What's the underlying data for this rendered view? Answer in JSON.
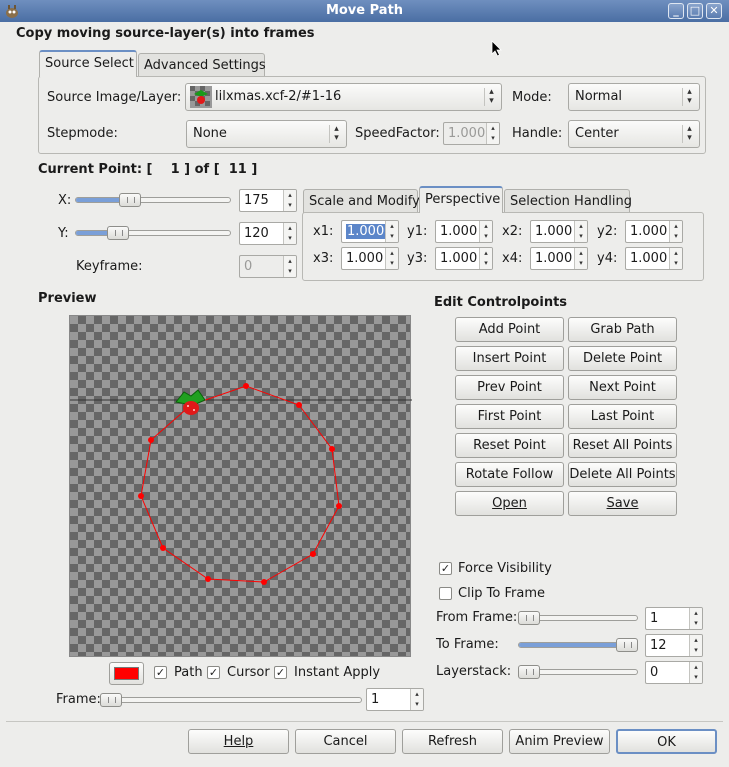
{
  "window": {
    "title": "Move Path",
    "controls": {
      "minimize": "_",
      "maximize": "□",
      "close": "✕"
    }
  },
  "header": "Copy moving source-layer(s) into frames",
  "tabs": {
    "source_select": "Source Select",
    "advanced_settings": "Advanced Settings"
  },
  "source": {
    "image_layer_label": "Source Image/Layer:",
    "image_layer_value": "lilxmas.xcf-2/#1-16",
    "mode_label": "Mode:",
    "mode_value": "Normal",
    "stepmode_label": "Stepmode:",
    "stepmode_value": "None",
    "speedfactor_label": "SpeedFactor:",
    "speedfactor_value": "1.000",
    "handle_label": "Handle:",
    "handle_value": "Center"
  },
  "current_point": {
    "text": "Current Point: [    1 ] of [  11 ]",
    "x_label": "X:",
    "x_value": "175",
    "x_level": 0.33,
    "y_label": "Y:",
    "y_value": "120",
    "y_level": 0.24,
    "keyframe_label": "Keyframe:",
    "keyframe_value": "0"
  },
  "modify_tabs": {
    "scale": "Scale and Modify",
    "perspective": "Perspective",
    "selection": "Selection Handling"
  },
  "perspective": [
    {
      "label": "x1:",
      "value": "1.000"
    },
    {
      "label": "y1:",
      "value": "1.000"
    },
    {
      "label": "x2:",
      "value": "1.000"
    },
    {
      "label": "y2:",
      "value": "1.000"
    },
    {
      "label": "x3:",
      "value": "1.000"
    },
    {
      "label": "y3:",
      "value": "1.000"
    },
    {
      "label": "x4:",
      "value": "1.000"
    },
    {
      "label": "y4:",
      "value": "1.000"
    }
  ],
  "preview": {
    "label": "Preview",
    "path_color": "#ff0000",
    "path_label": "Path",
    "cursor_label": "Cursor",
    "instant_apply_label": "Instant Apply",
    "frame_label": "Frame:",
    "frame_value": "1",
    "frame_level": 0.0
  },
  "controlpoints": {
    "title": "Edit Controlpoints",
    "buttons": [
      "Add Point",
      "Grab Path",
      "Insert Point",
      "Delete Point",
      "Prev Point",
      "Next Point",
      "First Point",
      "Last Point",
      "Reset Point",
      "Reset All Points",
      "Rotate Follow",
      "Delete All Points",
      "Open",
      "Save"
    ]
  },
  "options": {
    "force_visibility": "Force Visibility",
    "clip_to_frame": "Clip To Frame",
    "from_frame_label": "From Frame:",
    "from_frame_value": "1",
    "from_frame_level": 0.0,
    "to_frame_label": "To Frame:",
    "to_frame_value": "12",
    "to_frame_level": 1.0,
    "layerstack_label": "Layerstack:",
    "layerstack_value": "0",
    "layerstack_level": 0.0
  },
  "footer": {
    "help": "Help",
    "cancel": "Cancel",
    "refresh": "Refresh",
    "anim_preview": "Anim Preview",
    "ok": "OK"
  }
}
